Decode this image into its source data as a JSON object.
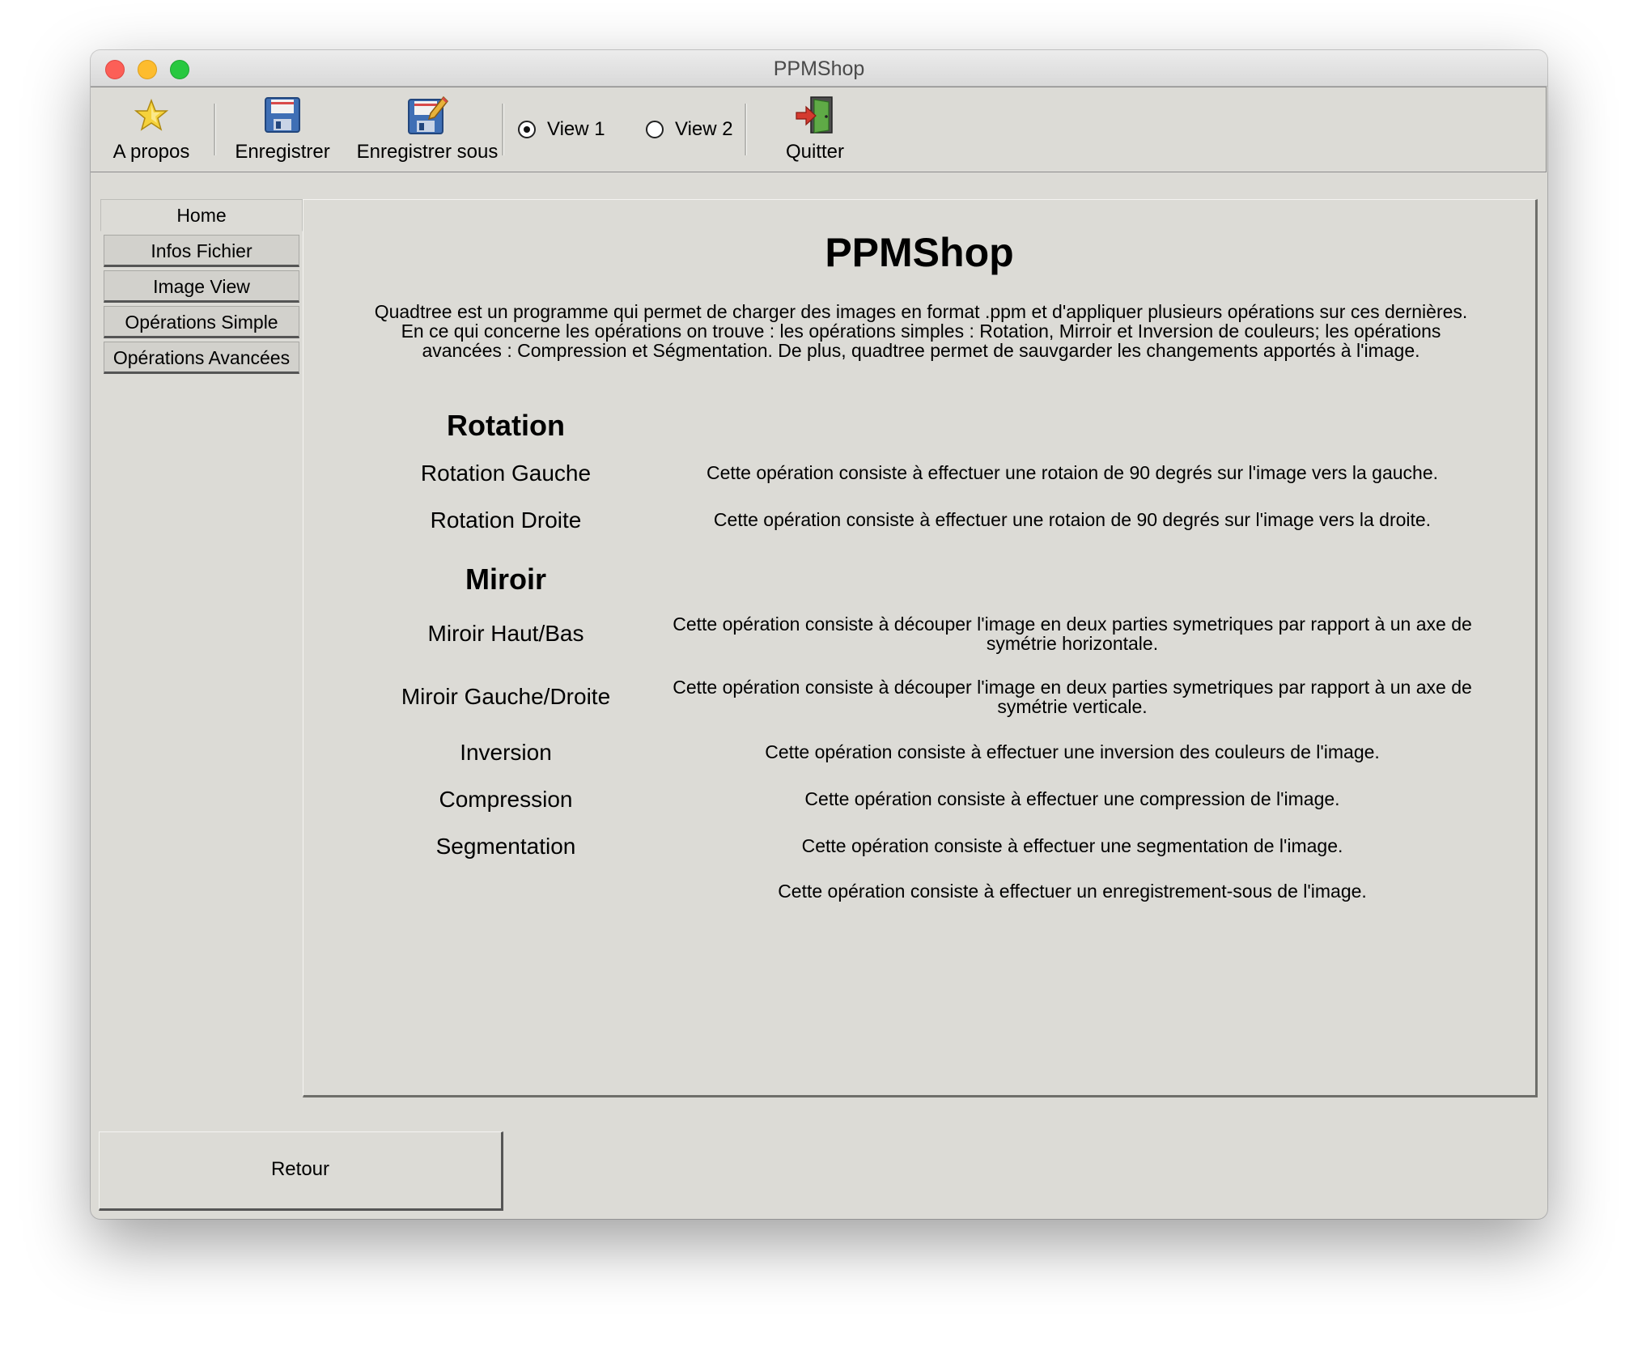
{
  "window": {
    "title": "PPMShop"
  },
  "toolbar": {
    "about": {
      "label": "A propos",
      "icon": "star-icon"
    },
    "save": {
      "label": "Enregistrer",
      "icon": "floppy-disk-icon"
    },
    "save_as": {
      "label": "Enregistrer sous",
      "icon": "floppy-disk-pen-icon"
    },
    "view1": {
      "label": "View 1",
      "selected": true
    },
    "view2": {
      "label": "View 2",
      "selected": false
    },
    "quit": {
      "label": "Quitter",
      "icon": "exit-door-icon"
    }
  },
  "sidebar": {
    "tabs": [
      {
        "label": "Home",
        "active": true
      },
      {
        "label": "Infos Fichier",
        "active": false
      },
      {
        "label": "Image View",
        "active": false
      },
      {
        "label": "Opérations Simple",
        "active": false
      },
      {
        "label": "Opérations Avancées",
        "active": false
      }
    ]
  },
  "content": {
    "title": "PPMShop",
    "intro": "Quadtree est un programme qui permet de charger des images en format .ppm et d'appliquer plusieurs opérations sur ces dernières. En ce qui concerne les opérations on trouve : les opérations simples : Rotation, Mirroir et Inversion de couleurs; les opérations avancées : Compression et Ségmentation. De plus, quadtree permet de sauvgarder les changements apportés à l'image.",
    "sections": {
      "rotation": "Rotation",
      "miroir": "Miroir"
    },
    "operations": [
      {
        "name": "Rotation Gauche",
        "desc": "Cette opération consiste à effectuer une rotaion de 90 degrés sur l'image vers la gauche."
      },
      {
        "name": "Rotation Droite",
        "desc": "Cette opération consiste à effectuer une rotaion de 90 degrés sur l'image vers la droite."
      },
      {
        "name": "Miroir Haut/Bas",
        "desc": "Cette opération consiste à découper l'image en deux parties symetriques par rapport à un axe de symétrie horizontale."
      },
      {
        "name": "Miroir Gauche/Droite",
        "desc": "Cette opération consiste à découper l'image en deux parties symetriques par rapport à un axe de symétrie verticale."
      },
      {
        "name": "Inversion",
        "desc": "Cette opération consiste à effectuer une inversion des couleurs de l'image."
      },
      {
        "name": "Compression",
        "desc": "Cette opération consiste à effectuer une compression de l'image."
      },
      {
        "name": "Segmentation",
        "desc": "Cette opération consiste à effectuer une segmentation de l'image."
      },
      {
        "name": "",
        "desc": "Cette opération consiste à effectuer un enregistrement-sous de l'image."
      }
    ]
  },
  "footer": {
    "back_label": "Retour"
  }
}
